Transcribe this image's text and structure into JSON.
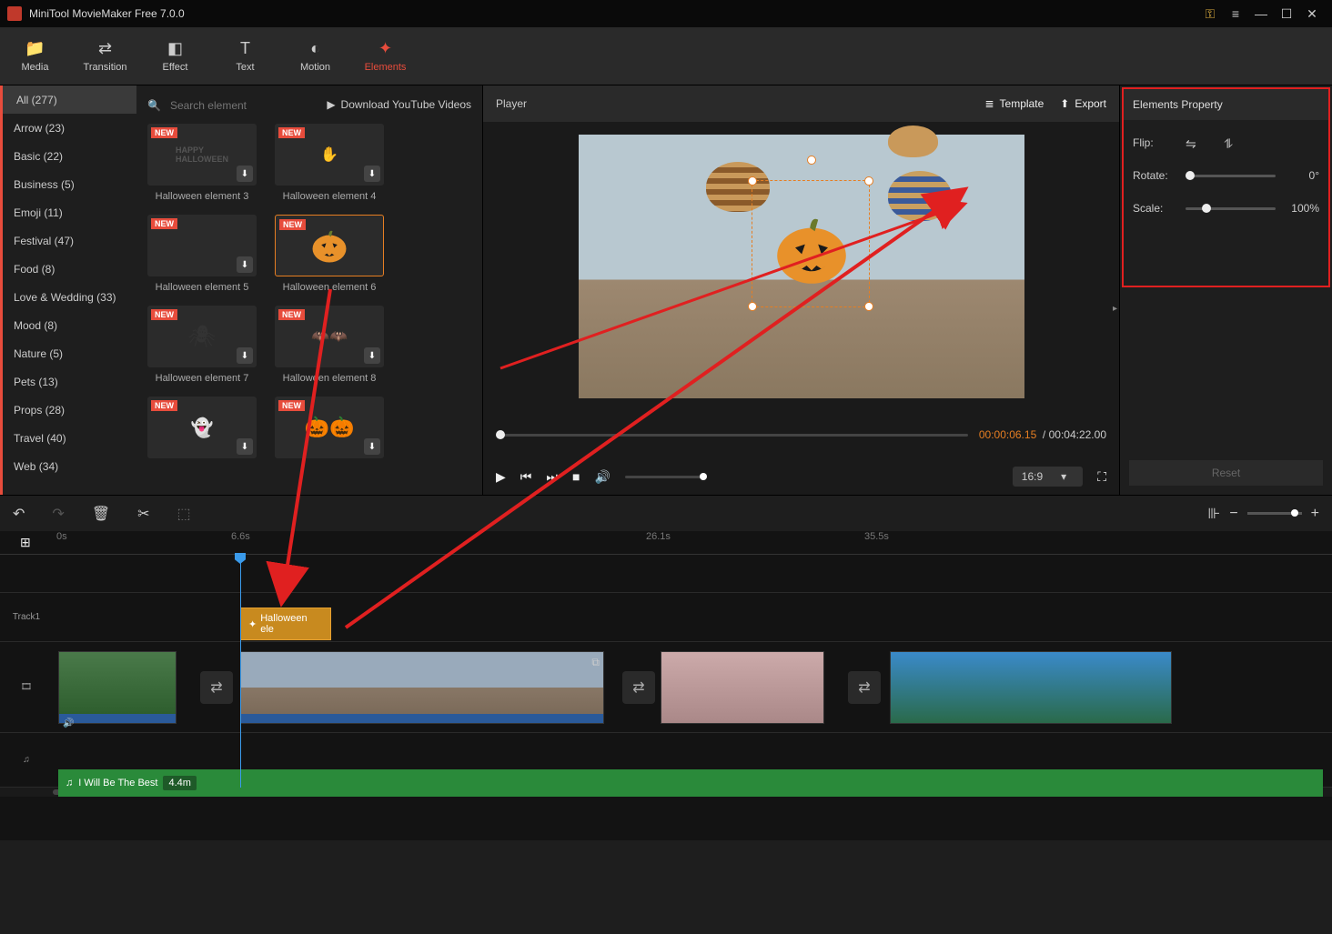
{
  "app": {
    "title": "MiniTool MovieMaker Free 7.0.0"
  },
  "topnav": {
    "media": "Media",
    "transition": "Transition",
    "effect": "Effect",
    "text": "Text",
    "motion": "Motion",
    "elements": "Elements"
  },
  "categories": {
    "all": "All (277)",
    "arrow": "Arrow (23)",
    "basic": "Basic (22)",
    "business": "Business (5)",
    "emoji": "Emoji (11)",
    "festival": "Festival (47)",
    "food": "Food (8)",
    "lovewedding": "Love & Wedding (33)",
    "mood": "Mood (8)",
    "nature": "Nature (5)",
    "pets": "Pets (13)",
    "props": "Props (28)",
    "travel": "Travel (40)",
    "web": "Web (34)"
  },
  "search": {
    "placeholder": "Search element"
  },
  "dlvideos": "Download YouTube Videos",
  "elements": {
    "newtag": "NEW",
    "e3": "Halloween element 3",
    "e4": "Halloween element 4",
    "e5": "Halloween element 5",
    "e6": "Halloween element 6",
    "e7": "Halloween element 7",
    "e8": "Halloween element 8"
  },
  "player": {
    "title": "Player",
    "template": "Template",
    "export": "Export",
    "current_time": "00:00:06.15",
    "total_time": "00:04:22.00",
    "aspect": "16:9"
  },
  "props": {
    "title": "Elements Property",
    "flip": "Flip:",
    "rotate": "Rotate:",
    "rotate_val": "0°",
    "scale": "Scale:",
    "scale_val": "100%",
    "reset": "Reset"
  },
  "timeline": {
    "marks": {
      "m0": "0s",
      "m1": "6.6s",
      "m2": "26.1s",
      "m3": "35.5s"
    },
    "track1": "Track1",
    "clip_label": "Halloween ele",
    "audio_name": "I Will Be The Best",
    "audio_dur": "4.4m"
  }
}
